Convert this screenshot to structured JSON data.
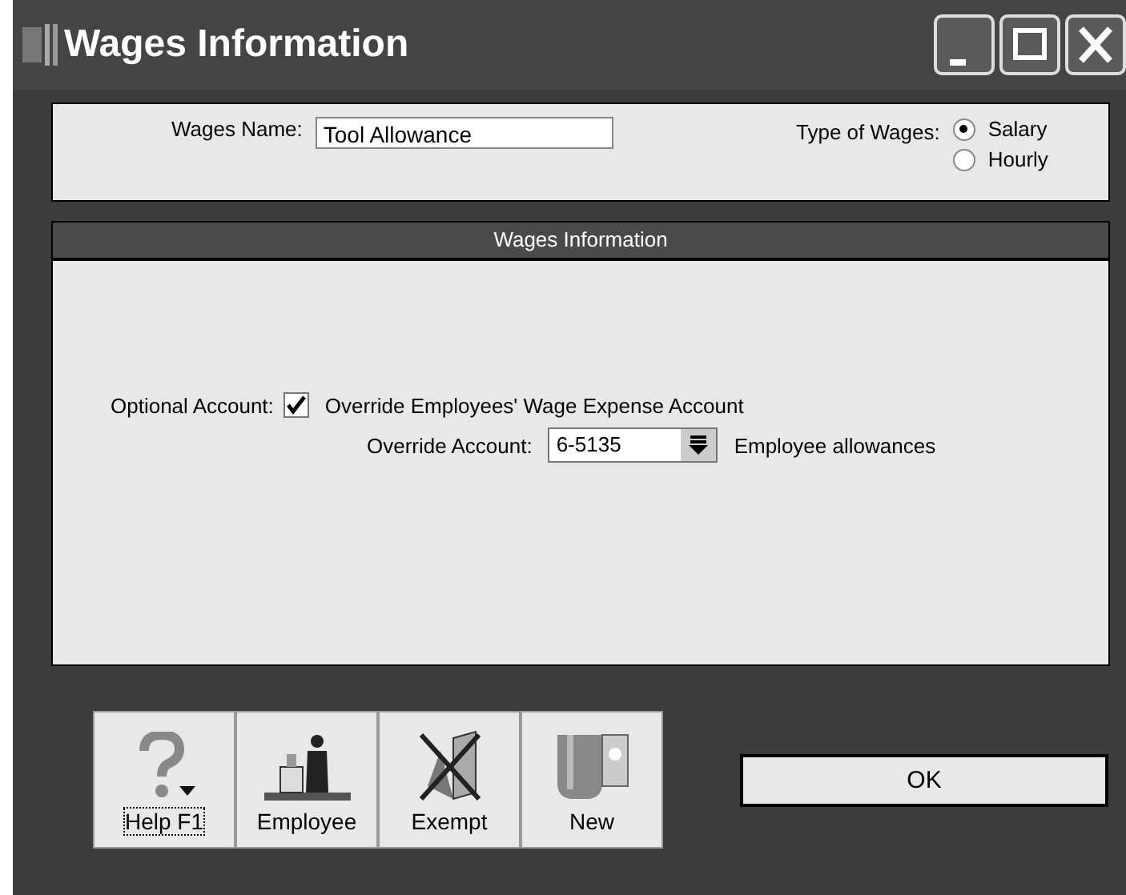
{
  "window": {
    "title": "Wages Information"
  },
  "wages_name": {
    "label": "Wages Name:",
    "value": "Tool Allowance"
  },
  "type_of_wages": {
    "label": "Type of Wages:",
    "options": [
      {
        "label": "Salary",
        "selected": true
      },
      {
        "label": "Hourly",
        "selected": false
      }
    ]
  },
  "section": {
    "title": "Wages Information"
  },
  "optional_account": {
    "label": "Optional Account:",
    "checkbox": {
      "label": "Override Employees' Wage Expense Account",
      "checked": true
    }
  },
  "override_account": {
    "label": "Override Account:",
    "value": "6-5135",
    "description": "Employee allowances"
  },
  "toolbar": [
    {
      "kind": "help",
      "label": "Help F1"
    },
    {
      "kind": "employee",
      "label": "Employee"
    },
    {
      "kind": "exempt",
      "label": "Exempt"
    },
    {
      "kind": "new",
      "label": "New"
    }
  ],
  "ok_button": {
    "label": "OK"
  }
}
